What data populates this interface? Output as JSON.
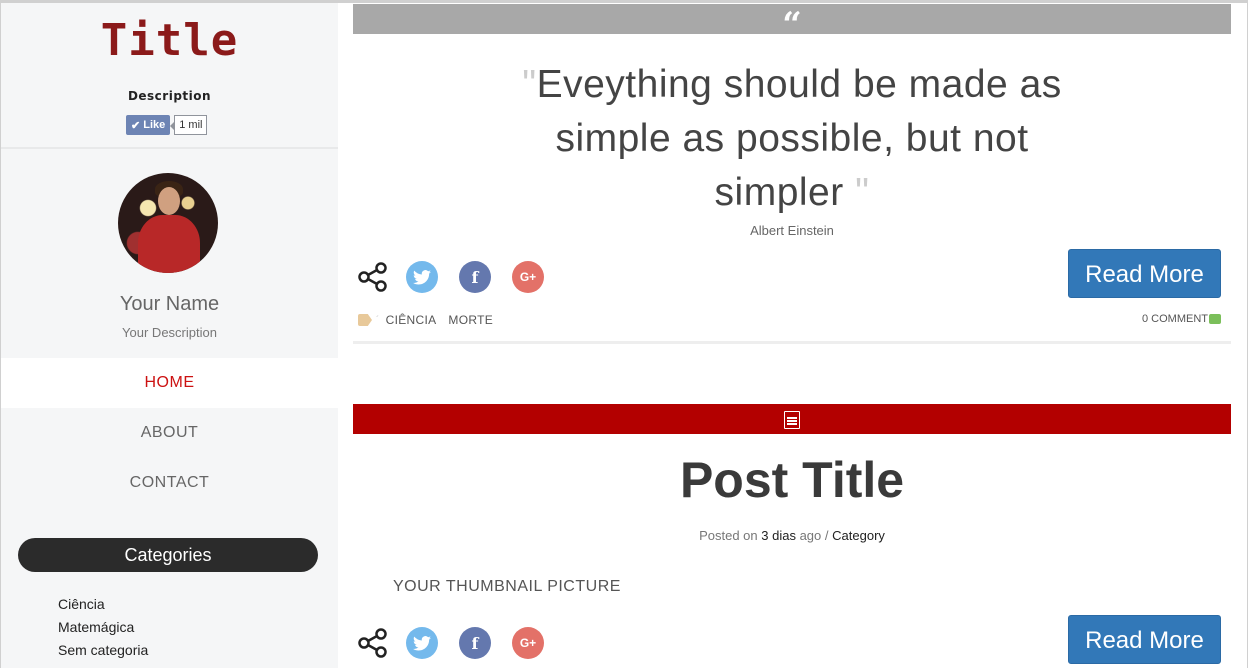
{
  "site": {
    "title": "Title",
    "description": "Description",
    "fb_like_label": "Like",
    "fb_like_count": "1 mil"
  },
  "profile": {
    "name": "Your Name",
    "description": "Your Description"
  },
  "nav": {
    "items": [
      {
        "label": "HOME",
        "active": true
      },
      {
        "label": "ABOUT",
        "active": false
      },
      {
        "label": "CONTACT",
        "active": false
      }
    ]
  },
  "categories": {
    "heading": "Categories",
    "items": [
      "Ciência",
      "Matemágica",
      "Sem categoria"
    ]
  },
  "posts": [
    {
      "type": "quote",
      "icon": "quote-icon",
      "bar_color": "#a8a8a8",
      "quote_open": "\"",
      "quote_body": "Eveything should be made as simple as possible, but not simpler ",
      "quote_close": "\"",
      "author": "Albert Einstein",
      "read_more": "Read More",
      "tags": [
        "CIÊNCIA",
        "MORTE"
      ],
      "comments": "0 COMMENT"
    },
    {
      "type": "standard",
      "icon": "document-icon",
      "bar_color": "#b30000",
      "title": "Post Title",
      "meta": {
        "posted_prefix": "Posted on",
        "date": "3 dias",
        "ago": "ago",
        "separator": "/",
        "category": "Category"
      },
      "thumbnail": "YOUR THUMBNAIL PICTURE",
      "read_more": "Read More"
    }
  ],
  "social": {
    "twitter_glyph": "🐦",
    "facebook_glyph": "f",
    "google_glyph": "G+"
  },
  "colors": {
    "title": "#8b1a1a",
    "nav_active": "#cc1111",
    "read_more": "#3278b8",
    "twitter": "#74b9ec",
    "facebook": "#6478ae",
    "google": "#e37168"
  }
}
